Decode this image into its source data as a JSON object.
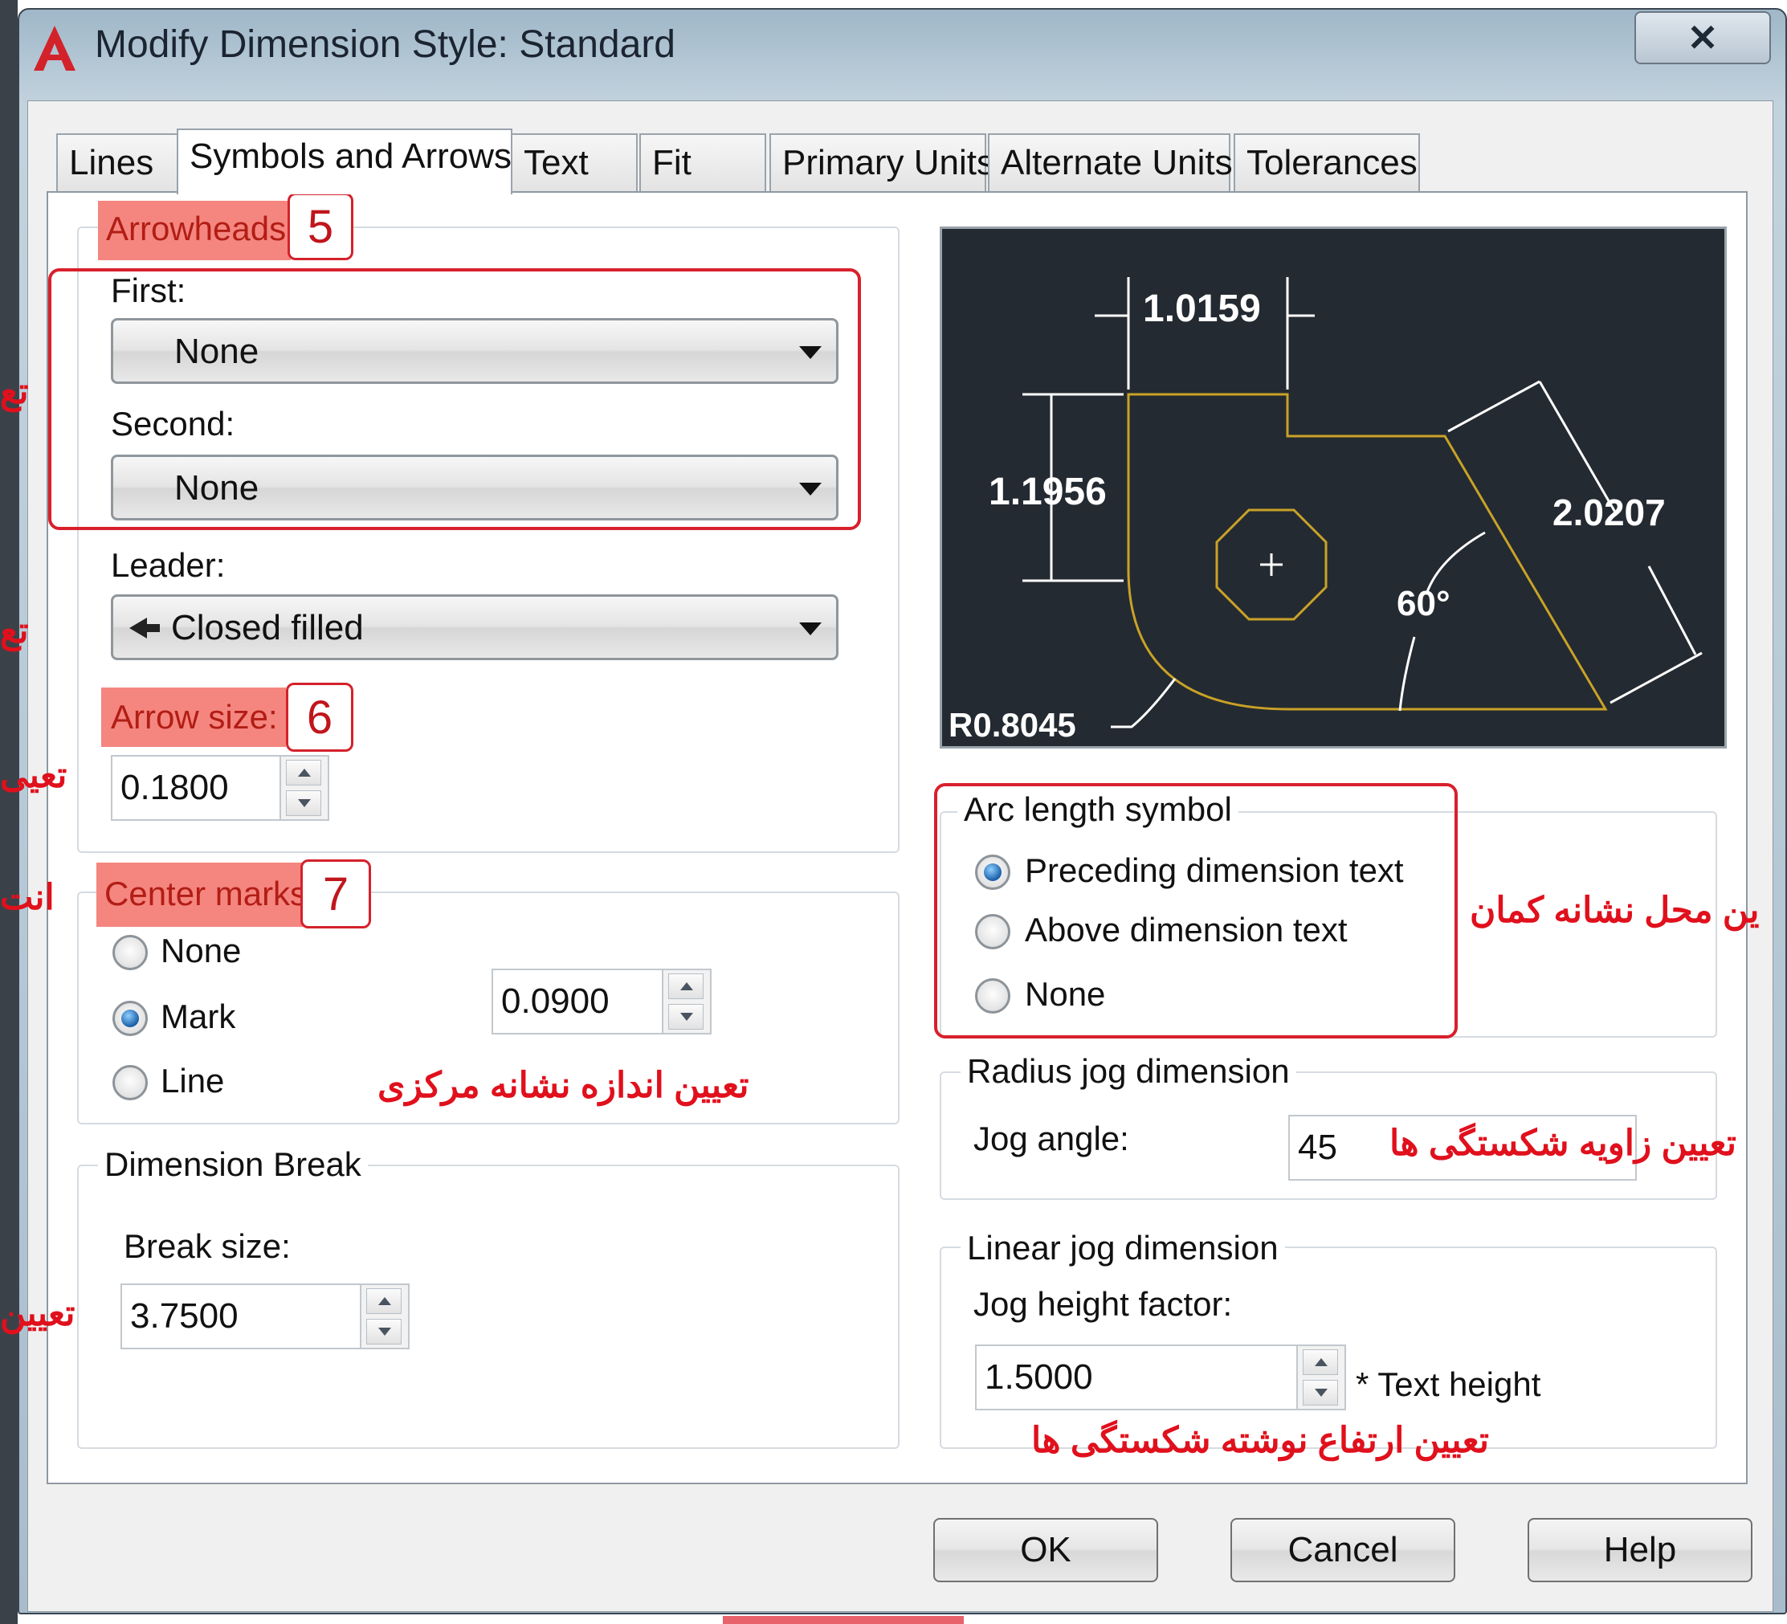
{
  "window": {
    "title": "Modify Dimension Style: Standard",
    "close_glyph": "✕"
  },
  "tabs": [
    {
      "label": "Lines"
    },
    {
      "label": "Symbols and Arrows"
    },
    {
      "label": "Text"
    },
    {
      "label": "Fit"
    },
    {
      "label": "Primary Units"
    },
    {
      "label": "Alternate Units"
    },
    {
      "label": "Tolerances"
    }
  ],
  "arrowheads": {
    "title": "Arrowheads",
    "badge": "5",
    "first_label": "First:",
    "first_value": "None",
    "second_label": "Second:",
    "second_value": "None",
    "leader_label": "Leader:",
    "leader_value": "Closed filled"
  },
  "arrow_size": {
    "label": "Arrow size:",
    "badge": "6",
    "value": "0.1800"
  },
  "center_marks": {
    "title": "Center marks",
    "badge": "7",
    "options": [
      "None",
      "Mark",
      "Line"
    ],
    "selected": "Mark",
    "value": "0.0900"
  },
  "dimension_break": {
    "title": "Dimension Break",
    "size_label": "Break size:",
    "size_value": "3.7500"
  },
  "preview": {
    "dim_top": "1.0159",
    "dim_left": "1.1956",
    "dim_right": "2.0207",
    "angle": "60°",
    "radius": "R0.8045"
  },
  "arc_length": {
    "title": "Arc length symbol",
    "options": [
      "Preceding dimension text",
      "Above dimension text",
      "None"
    ],
    "selected": "Preceding dimension text"
  },
  "radius_jog": {
    "title": "Radius jog dimension",
    "angle_label": "Jog angle:",
    "angle_value": "45"
  },
  "linear_jog": {
    "title": "Linear jog dimension",
    "factor_label": "Jog height factor:",
    "factor_value": "1.5000",
    "suffix": "* Text height"
  },
  "annotations": {
    "center_mark_size": "تعیین اندازه نشانه مرکزی",
    "arc_symbol_position": "ین محل نشانه کمان",
    "jog_angle": "تعیین زاویه شکستگی ها",
    "jog_text_height": "تعیین ارتفاع نوشته شکستگی ها",
    "left_1": "تع",
    "left_2": "تع",
    "left_3": "تعیی",
    "left_4": "انت",
    "left_5": "تعیین"
  },
  "buttons": {
    "ok": "OK",
    "cancel": "Cancel",
    "help": "Help"
  },
  "colors": {
    "accent_red": "#d8202c",
    "highlight": "#f4867f",
    "preview_bg": "#242a31",
    "geometry": "#c9a227"
  }
}
